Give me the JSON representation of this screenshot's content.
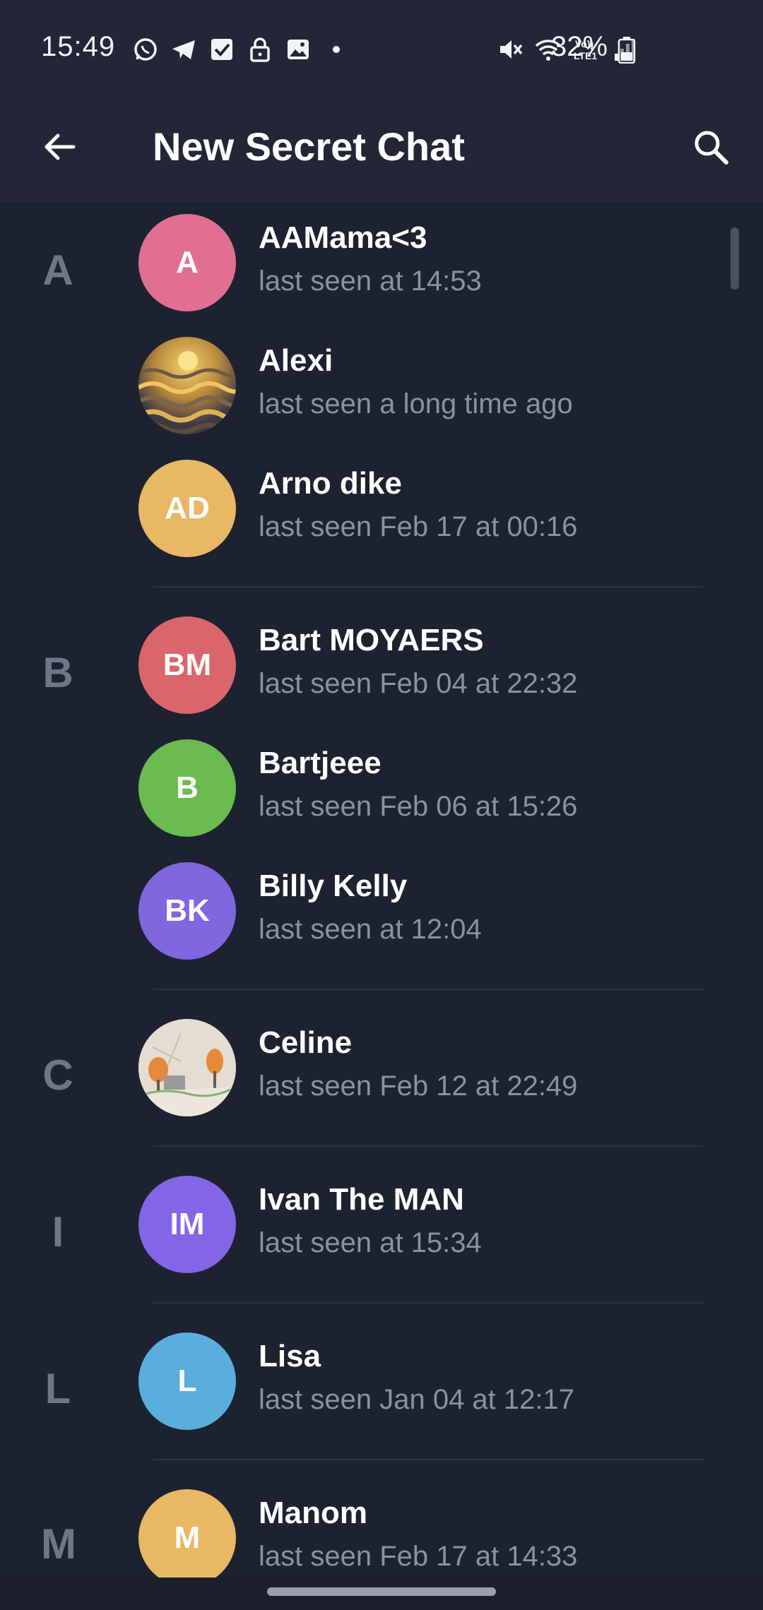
{
  "status_bar": {
    "time": "15:49",
    "battery_percent": "32%",
    "left_icons": [
      "whatsapp-icon",
      "telegram-icon",
      "checkbox-icon",
      "lock-icon",
      "image-icon",
      "dot-icon"
    ],
    "right_icons": [
      "mute-icon",
      "wifi-icon",
      "volte-icon",
      "signal-icon"
    ]
  },
  "header": {
    "title": "New Secret Chat",
    "back_icon": "arrow-left-icon",
    "search_icon": "search-icon"
  },
  "sections": [
    {
      "letter": "A"
    },
    {
      "letter": "B"
    },
    {
      "letter": "C"
    },
    {
      "letter": "I"
    },
    {
      "letter": "L"
    },
    {
      "letter": "M"
    }
  ],
  "contacts": [
    {
      "name": "AAMama<3",
      "status": "last seen at 14:53",
      "initials": "A",
      "color": "#e06f92",
      "photo": false
    },
    {
      "name": "Alexi",
      "status": "last seen a long time ago",
      "initials": "",
      "color": "#8a6a3a",
      "photo": true
    },
    {
      "name": "Arno dike",
      "status": "last seen Feb 17 at 00:16",
      "initials": "AD",
      "color": "#e8b865",
      "photo": false
    },
    {
      "name": "Bart MOYAERS",
      "status": "last seen Feb 04 at 22:32",
      "initials": "BM",
      "color": "#d9666a",
      "photo": false
    },
    {
      "name": "Bartjeee",
      "status": "last seen Feb 06 at 15:26",
      "initials": "B",
      "color": "#6bbb4e",
      "photo": false
    },
    {
      "name": "Billy Kelly",
      "status": "last seen at 12:04",
      "initials": "BK",
      "color": "#7f67e0",
      "photo": false
    },
    {
      "name": "Celine",
      "status": "last seen Feb 12 at 22:49",
      "initials": "",
      "color": "#d9d2c8",
      "photo": true
    },
    {
      "name": "Ivan The MAN",
      "status": "last seen at 15:34",
      "initials": "IM",
      "color": "#8366e6",
      "photo": false
    },
    {
      "name": "Lisa",
      "status": "last seen Jan 04 at 12:17",
      "initials": "L",
      "color": "#5aaedc",
      "photo": false
    },
    {
      "name": "Manom",
      "status": "last seen Feb 17 at 14:33",
      "initials": "M",
      "color": "#e8b865",
      "photo": false
    }
  ]
}
